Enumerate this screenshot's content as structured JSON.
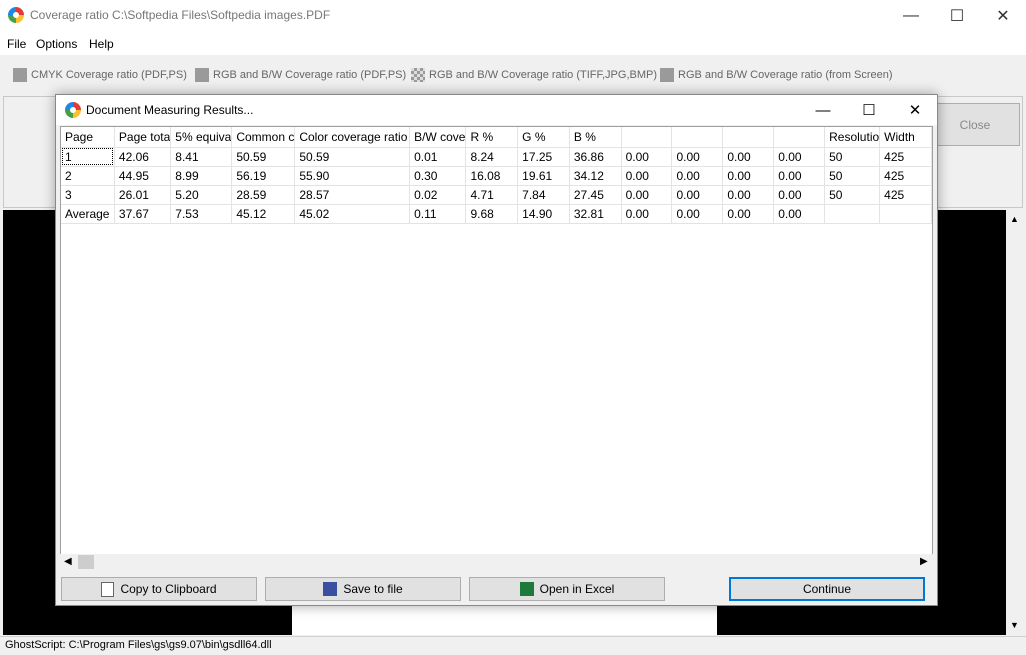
{
  "window": {
    "title": "Coverage ratio  C:\\Softpedia Files\\Softpedia images.PDF",
    "minimize": "—",
    "maximize": "☐",
    "close": "✕"
  },
  "menu": [
    "File",
    "Options",
    "Help"
  ],
  "toolbar": [
    {
      "label": "CMYK Coverage ratio  (PDF,PS)",
      "icon": "cmyk-icon"
    },
    {
      "label": "RGB and B/W Coverage ratio (PDF,PS)",
      "icon": "printer-icon"
    },
    {
      "label": "RGB and B/W Coverage ratio (TIFF,JPG,BMP)",
      "icon": "image-icon"
    },
    {
      "label": "RGB and B/W Coverage ratio (from Screen)",
      "icon": "screen-icon"
    }
  ],
  "panel": {
    "close_label": "Close"
  },
  "status": {
    "text": "GhostScript: C:\\Program Files\\gs\\gs9.07\\bin\\gsdll64.dll"
  },
  "dialog": {
    "title": "Document Measuring Results...",
    "minimize": "—",
    "maximize": "☐",
    "close": "✕",
    "columns": [
      "Page",
      "Page tota",
      "5% equiva",
      "Common c",
      "Color coverage ratio",
      "B/W cove",
      "R %",
      "G %",
      "B %",
      "",
      "",
      "",
      "",
      "Resolutio",
      "Width"
    ],
    "rows": [
      [
        "1",
        "42.06",
        "8.41",
        "50.59",
        "50.59",
        "0.01",
        "8.24",
        "17.25",
        "36.86",
        "0.00",
        "0.00",
        "0.00",
        "0.00",
        "50",
        "425"
      ],
      [
        "2",
        "44.95",
        "8.99",
        "56.19",
        "55.90",
        "0.30",
        "16.08",
        "19.61",
        "34.12",
        "0.00",
        "0.00",
        "0.00",
        "0.00",
        "50",
        "425"
      ],
      [
        "3",
        "26.01",
        "5.20",
        "28.59",
        "28.57",
        "0.02",
        "4.71",
        "7.84",
        "27.45",
        "0.00",
        "0.00",
        "0.00",
        "0.00",
        "50",
        "425"
      ],
      [
        "Average",
        "37.67",
        "7.53",
        "45.12",
        "45.02",
        "0.11",
        "9.68",
        "14.90",
        "32.81",
        "0.00",
        "0.00",
        "0.00",
        "0.00",
        "",
        ""
      ]
    ],
    "buttons": {
      "copy": "Copy to Clipboard",
      "save": "Save to file",
      "excel": "Open in Excel",
      "continue": "Continue"
    }
  },
  "colors": {
    "accent": "#0078d7",
    "excel_green": "#1d7a3a",
    "save_blue": "#3a4fa0"
  }
}
